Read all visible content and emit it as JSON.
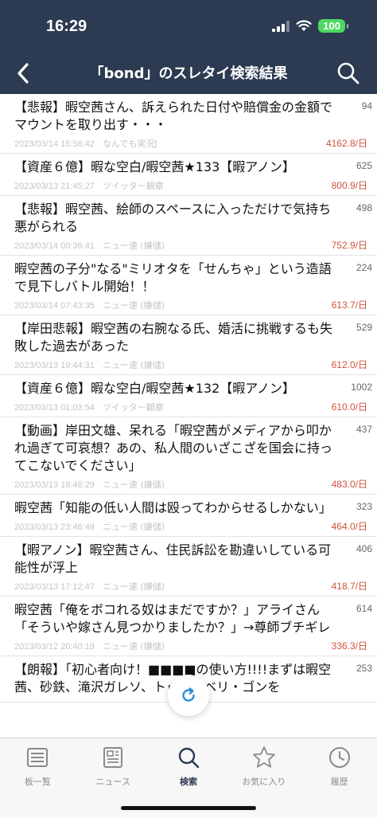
{
  "status_bar": {
    "time": "16:29",
    "battery": "100"
  },
  "navbar": {
    "title": "「bond」のスレタイ検索結果"
  },
  "threads": [
    {
      "title": "【悲報】暇空茜さん、訴えられた日付や賠償金の金額でマウントを取り出す・・・",
      "count": "94",
      "date": "2023/03/14 15:56:42",
      "board": "なんでも実況J",
      "speed": "4162.8/日"
    },
    {
      "title": "【資産６億】暇な空白/暇空茜★133【暇アノン】",
      "count": "625",
      "date": "2023/03/13 21:45:27",
      "board": "ツイッター観察",
      "speed": "800.9/日"
    },
    {
      "title": "【悲報】暇空茜、絵師のスペースに入っただけで気持ち悪がられる",
      "count": "498",
      "date": "2023/03/14 00:36:41",
      "board": "ニュー速 (嫌儲)",
      "speed": "752.9/日"
    },
    {
      "title": "暇空茜の子分\"なる\"ミリオタを「せんちゃ」という造語で見下しバトル開始！！",
      "count": "224",
      "date": "2023/03/14 07:43:35",
      "board": "ニュー速 (嫌儲)",
      "speed": "613.7/日"
    },
    {
      "title": "【岸田悲報】暇空茜の右腕なる氏、婚活に挑戦するも失敗した過去があった",
      "count": "529",
      "date": "2023/03/13 19:44:31",
      "board": "ニュー速 (嫌儲)",
      "speed": "612.0/日"
    },
    {
      "title": "【資産６億】暇な空白/暇空茜★132【暇アノン】",
      "count": "1002",
      "date": "2023/03/13 01:03:54",
      "board": "ツイッター観察",
      "speed": "610.0/日"
    },
    {
      "title": "【動画】岸田文雄、呆れる「暇空茜がメディアから叩かれ過ぎて可哀想？あの、私人間のいざこざを国会に持ってこないでください」",
      "count": "437",
      "date": "2023/03/13 18:46:29",
      "board": "ニュー速 (嫌儲)",
      "speed": "483.0/日"
    },
    {
      "title": "暇空茜「知能の低い人間は殴ってわからせるしかない」",
      "count": "323",
      "date": "2023/03/13 23:46:49",
      "board": "ニュー速 (嫌儲)",
      "speed": "464.0/日"
    },
    {
      "title": "【暇アノン】暇空茜さん、住民訴訟を勘違いしている可能性が浮上",
      "count": "406",
      "date": "2023/03/13 17:12:47",
      "board": "ニュー速 (嫌儲)",
      "speed": "418.7/日"
    },
    {
      "title": "暇空茜「俺をボコれる奴はまだですか？」アライさん「そういや嫁さん見つかりましたか？」→尊師ブチギレ",
      "count": "614",
      "date": "2023/03/12 20:40:19",
      "board": "ニュー速 (嫌儲)",
      "speed": "336.3/日"
    },
    {
      "title": "【朗報】「初心者向け！■■■■の使い方!!!!まずは暇空茜、砂鉄、滝沢ガレソ、トゥーンベリ・ゴンを",
      "count": "253",
      "date": "",
      "board": "",
      "speed": ""
    }
  ],
  "tabs": [
    {
      "label": "板一覧",
      "icon": "board-list-icon",
      "active": false
    },
    {
      "label": "ニュース",
      "icon": "news-icon",
      "active": false
    },
    {
      "label": "検索",
      "icon": "search-icon",
      "active": true
    },
    {
      "label": "お気に入り",
      "icon": "star-icon",
      "active": false
    },
    {
      "label": "履歴",
      "icon": "history-icon",
      "active": false
    }
  ],
  "colors": {
    "header_bg": "#2c3a52",
    "speed_text": "#d0533b",
    "battery": "#4cd964",
    "refresh_accent": "#2b8fd6"
  }
}
